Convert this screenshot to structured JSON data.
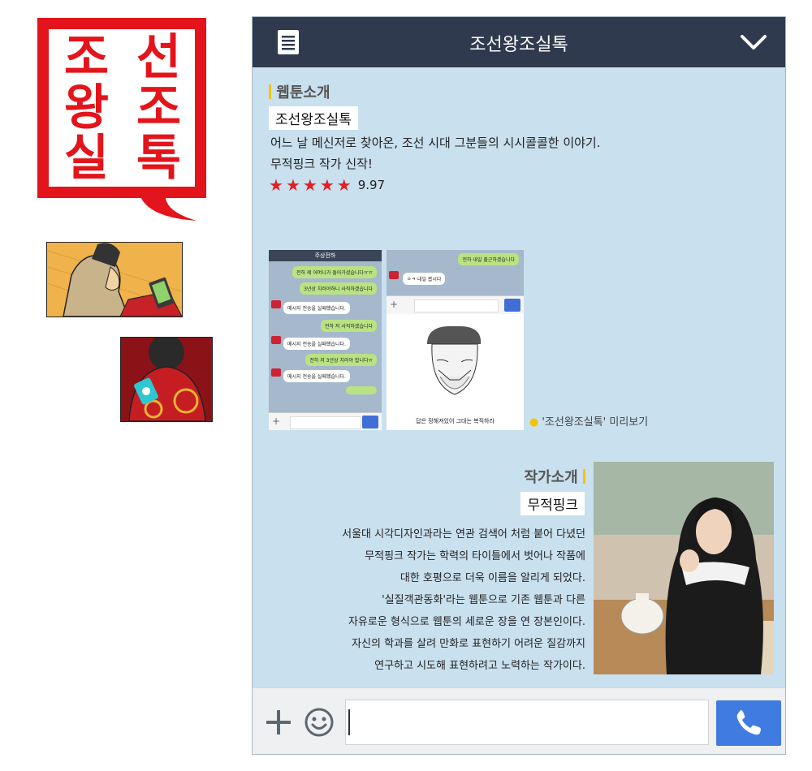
{
  "logo": {
    "chars": [
      "조",
      "선",
      "왕",
      "조",
      "실",
      "톡"
    ],
    "color": "#e3141b"
  },
  "header": {
    "title": "조선왕조실톡",
    "menu_icon": "list-icon",
    "collapse_icon": "chevron-down-icon",
    "bg_color": "#2f3a4e"
  },
  "intro": {
    "section_title": "웹툰소개",
    "name": "조선왕조실톡",
    "description_lines": [
      "어느 날 메신저로 찾아온, 조선 시대 그분들의 시시콜콜한 이야기.",
      "무적핑크 작가 신작!"
    ],
    "rating_stars": 5,
    "rating_score": "9.97",
    "star_color": "#e12026"
  },
  "preview": {
    "caption": "'조선왕조실톡' 미리보기",
    "phone_a": {
      "title": "주상전하",
      "messages": [
        {
          "side": "right",
          "text": "전하 제 어머니가 돌아가셨습니다ㅠㅠ"
        },
        {
          "side": "right",
          "text": "3년상 치러야하니 사직하겠습니다"
        },
        {
          "side": "left",
          "text": "메시지 전송을 실패했습니다."
        },
        {
          "side": "right",
          "text": "전하 저 사직하겠습니다"
        },
        {
          "side": "left",
          "text": "메시지 전송을 실패했습니다."
        },
        {
          "side": "right",
          "text": "전하 저 3년상 치러야 합니다ㅠ"
        },
        {
          "side": "left",
          "text": "메시지 전송을 실패했습니다."
        }
      ]
    },
    "phone_b": {
      "messages": [
        {
          "side": "right",
          "text": "전하 내일 출근하겠습니다"
        },
        {
          "side": "left",
          "text": "ㅇㅋ 내일 봅시다"
        }
      ],
      "bottom_text": "답은 정해져있어 그대는 복직하라"
    }
  },
  "author": {
    "section_title": "작가소개",
    "name": "무적핑크",
    "bio_lines": [
      "서울대 시각디자인과라는 연관 검색어 처럼 붙어 다녔던",
      "무적핑크 작가는 학력의 타이틀에서 벗어나 작품에",
      "대한 호평으로 더욱 이름을 알리게 되었다.",
      "'실질객관동화'라는 웹툰으로 기존 웹툰과 다른",
      "자유로운 형식으로 웹툰의 세로운 장을 연 장본인이다.",
      "자신의 학과를 살려 만화로 표현하기 어려운 질감까지",
      "연구하고 시도해 표현하려고 노력하는 작가이다."
    ]
  },
  "footer": {
    "plus_icon": "plus-icon",
    "emoji_icon": "smiley-icon",
    "input_value": "",
    "send_icon": "phone-icon",
    "send_color": "#3f7be0"
  },
  "panel_bg": "#c9e0ee",
  "accent": "#f5c400"
}
